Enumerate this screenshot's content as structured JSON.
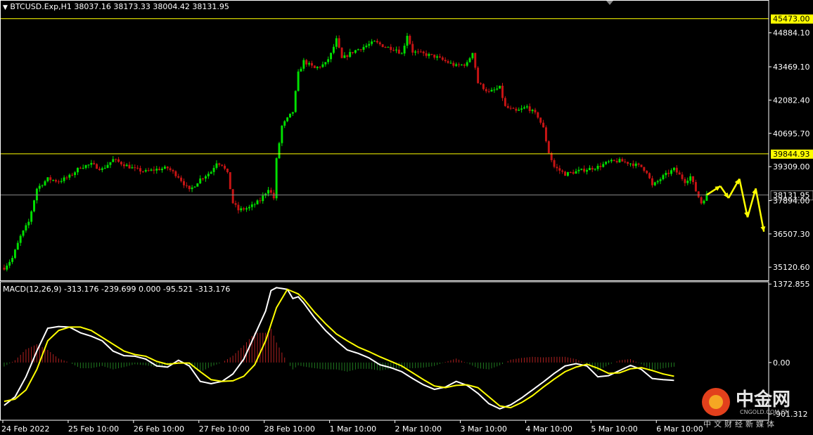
{
  "window": {
    "symbol_header": "BTCUSD.Exp,H1  38037.16 38173.33 38004.42 38131.95",
    "macd_header": "MACD(12,26,9) -313.176 -239.699 0.000 -95.521 -313.176"
  },
  "colors": {
    "background": "#000000",
    "bull": "#00e000",
    "bear": "#c81414",
    "level_line": "#ffff00",
    "current_line": "#8a8a8a",
    "macd_line": "#ffffff",
    "signal_line": "#ffff00",
    "hist_pos": "#b02020",
    "hist_neg": "#207a20"
  },
  "chart_data": {
    "type": "candlestick",
    "price_axis": {
      "ylim": [
        34600,
        45900
      ],
      "ticks": [
        "44884.10",
        "43469.10",
        "42082.40",
        "40695.70",
        "39309.00",
        "37894.00",
        "36507.30",
        "35120.60"
      ]
    },
    "levels": [
      {
        "label": "45473.00",
        "value": 45473.0
      },
      {
        "label": "39844.93",
        "value": 39844.93
      }
    ],
    "current_price": {
      "label": "38131.95",
      "value": 38131.95
    },
    "x_axis": {
      "labels": [
        "24 Feb 2022",
        "25 Feb 10:00",
        "26 Feb 10:00",
        "27 Feb 10:00",
        "28 Feb 10:00",
        "1 Mar 10:00",
        "2 Mar 10:00",
        "3 Mar 10:00",
        "4 Mar 10:00",
        "5 Mar 10:00",
        "6 Mar 10:00"
      ],
      "bars_per_label": 24
    },
    "price_keypoints": [
      [
        0,
        35100
      ],
      [
        3,
        35500
      ],
      [
        6,
        36400
      ],
      [
        9,
        37000
      ],
      [
        12,
        38400
      ],
      [
        16,
        38800
      ],
      [
        20,
        38700
      ],
      [
        24,
        38900
      ],
      [
        28,
        39300
      ],
      [
        32,
        39400
      ],
      [
        36,
        39200
      ],
      [
        40,
        39600
      ],
      [
        44,
        39400
      ],
      [
        48,
        39200
      ],
      [
        52,
        39100
      ],
      [
        56,
        39200
      ],
      [
        60,
        39250
      ],
      [
        64,
        38900
      ],
      [
        68,
        38300
      ],
      [
        72,
        38800
      ],
      [
        76,
        39100
      ],
      [
        78,
        39500
      ],
      [
        80,
        39400
      ],
      [
        82,
        39000
      ],
      [
        84,
        37800
      ],
      [
        86,
        37500
      ],
      [
        90,
        37600
      ],
      [
        94,
        37900
      ],
      [
        97,
        38400
      ],
      [
        99,
        38000
      ],
      [
        100,
        39600
      ],
      [
        102,
        41000
      ],
      [
        104,
        41300
      ],
      [
        106,
        41600
      ],
      [
        108,
        43200
      ],
      [
        110,
        43700
      ],
      [
        114,
        43400
      ],
      [
        118,
        43600
      ],
      [
        120,
        44000
      ],
      [
        122,
        44600
      ],
      [
        124,
        43800
      ],
      [
        128,
        44100
      ],
      [
        132,
        44300
      ],
      [
        136,
        44500
      ],
      [
        140,
        44300
      ],
      [
        144,
        44200
      ],
      [
        146,
        44000
      ],
      [
        148,
        44800
      ],
      [
        150,
        44100
      ],
      [
        154,
        44000
      ],
      [
        158,
        43900
      ],
      [
        162,
        43700
      ],
      [
        166,
        43500
      ],
      [
        170,
        43600
      ],
      [
        172,
        44100
      ],
      [
        174,
        42800
      ],
      [
        178,
        42400
      ],
      [
        182,
        42600
      ],
      [
        184,
        41800
      ],
      [
        188,
        41600
      ],
      [
        192,
        41800
      ],
      [
        196,
        41400
      ],
      [
        198,
        40900
      ],
      [
        200,
        39900
      ],
      [
        202,
        39300
      ],
      [
        206,
        39000
      ],
      [
        210,
        39100
      ],
      [
        214,
        39200
      ],
      [
        218,
        39300
      ],
      [
        222,
        39500
      ],
      [
        226,
        39550
      ],
      [
        230,
        39450
      ],
      [
        234,
        39300
      ],
      [
        236,
        39100
      ],
      [
        238,
        38500
      ],
      [
        240,
        38700
      ],
      [
        242,
        38900
      ],
      [
        246,
        39200
      ],
      [
        250,
        38700
      ],
      [
        252,
        38900
      ],
      [
        254,
        38300
      ],
      [
        256,
        37800
      ],
      [
        258,
        38131.95
      ]
    ],
    "projection": [
      [
        258,
        38131.95
      ],
      [
        263,
        38500
      ],
      [
        266,
        38000
      ],
      [
        270,
        38800
      ],
      [
        273,
        37200
      ],
      [
        276,
        38400
      ],
      [
        279,
        36600
      ]
    ],
    "macd": {
      "axis": {
        "ylim": [
          -1010,
          1400
        ],
        "ticks": [
          "1372.855",
          "0.00",
          "-901.312"
        ]
      },
      "macd_keypoints": [
        [
          0,
          -750
        ],
        [
          4,
          -600
        ],
        [
          8,
          -250
        ],
        [
          12,
          200
        ],
        [
          16,
          600
        ],
        [
          20,
          630
        ],
        [
          24,
          620
        ],
        [
          28,
          520
        ],
        [
          32,
          460
        ],
        [
          36,
          380
        ],
        [
          40,
          200
        ],
        [
          44,
          120
        ],
        [
          48,
          110
        ],
        [
          52,
          60
        ],
        [
          56,
          -60
        ],
        [
          60,
          -80
        ],
        [
          64,
          40
        ],
        [
          68,
          -60
        ],
        [
          72,
          -330
        ],
        [
          76,
          -370
        ],
        [
          80,
          -330
        ],
        [
          84,
          -200
        ],
        [
          88,
          60
        ],
        [
          92,
          480
        ],
        [
          96,
          900
        ],
        [
          98,
          1260
        ],
        [
          100,
          1310
        ],
        [
          104,
          1280
        ],
        [
          106,
          1120
        ],
        [
          108,
          1150
        ],
        [
          110,
          1040
        ],
        [
          114,
          780
        ],
        [
          118,
          560
        ],
        [
          122,
          380
        ],
        [
          126,
          220
        ],
        [
          130,
          160
        ],
        [
          134,
          80
        ],
        [
          138,
          -40
        ],
        [
          142,
          -90
        ],
        [
          146,
          -160
        ],
        [
          150,
          -280
        ],
        [
          154,
          -390
        ],
        [
          158,
          -470
        ],
        [
          162,
          -430
        ],
        [
          166,
          -330
        ],
        [
          170,
          -400
        ],
        [
          174,
          -540
        ],
        [
          178,
          -720
        ],
        [
          182,
          -810
        ],
        [
          186,
          -740
        ],
        [
          190,
          -620
        ],
        [
          194,
          -480
        ],
        [
          198,
          -340
        ],
        [
          202,
          -190
        ],
        [
          206,
          -60
        ],
        [
          210,
          -20
        ],
        [
          214,
          -60
        ],
        [
          218,
          -250
        ],
        [
          222,
          -230
        ],
        [
          226,
          -140
        ],
        [
          230,
          -50
        ],
        [
          234,
          -120
        ],
        [
          238,
          -280
        ],
        [
          242,
          -300
        ],
        [
          246,
          -313
        ]
      ],
      "signal_keypoints": [
        [
          0,
          -680
        ],
        [
          4,
          -640
        ],
        [
          8,
          -480
        ],
        [
          12,
          -120
        ],
        [
          16,
          380
        ],
        [
          20,
          560
        ],
        [
          24,
          620
        ],
        [
          28,
          620
        ],
        [
          32,
          560
        ],
        [
          36,
          440
        ],
        [
          40,
          320
        ],
        [
          44,
          200
        ],
        [
          48,
          140
        ],
        [
          52,
          110
        ],
        [
          56,
          20
        ],
        [
          60,
          -30
        ],
        [
          64,
          -10
        ],
        [
          68,
          -10
        ],
        [
          72,
          -160
        ],
        [
          76,
          -300
        ],
        [
          80,
          -330
        ],
        [
          84,
          -320
        ],
        [
          88,
          -240
        ],
        [
          92,
          -40
        ],
        [
          96,
          380
        ],
        [
          100,
          960
        ],
        [
          104,
          1280
        ],
        [
          108,
          1200
        ],
        [
          110,
          1110
        ],
        [
          114,
          880
        ],
        [
          118,
          680
        ],
        [
          122,
          500
        ],
        [
          126,
          380
        ],
        [
          130,
          270
        ],
        [
          134,
          190
        ],
        [
          138,
          100
        ],
        [
          142,
          20
        ],
        [
          146,
          -60
        ],
        [
          150,
          -180
        ],
        [
          154,
          -300
        ],
        [
          158,
          -410
        ],
        [
          162,
          -440
        ],
        [
          166,
          -400
        ],
        [
          170,
          -390
        ],
        [
          174,
          -440
        ],
        [
          178,
          -600
        ],
        [
          182,
          -760
        ],
        [
          186,
          -790
        ],
        [
          190,
          -700
        ],
        [
          194,
          -580
        ],
        [
          198,
          -430
        ],
        [
          202,
          -290
        ],
        [
          206,
          -160
        ],
        [
          210,
          -80
        ],
        [
          214,
          -30
        ],
        [
          218,
          -100
        ],
        [
          222,
          -190
        ],
        [
          226,
          -180
        ],
        [
          230,
          -110
        ],
        [
          234,
          -90
        ],
        [
          238,
          -140
        ],
        [
          242,
          -200
        ],
        [
          246,
          -239.7
        ]
      ]
    }
  },
  "watermark": {
    "name_cn": "中金网",
    "name_en": "CNGOLD.COM.CN",
    "subtitle_cn": "中文财经新媒体"
  }
}
